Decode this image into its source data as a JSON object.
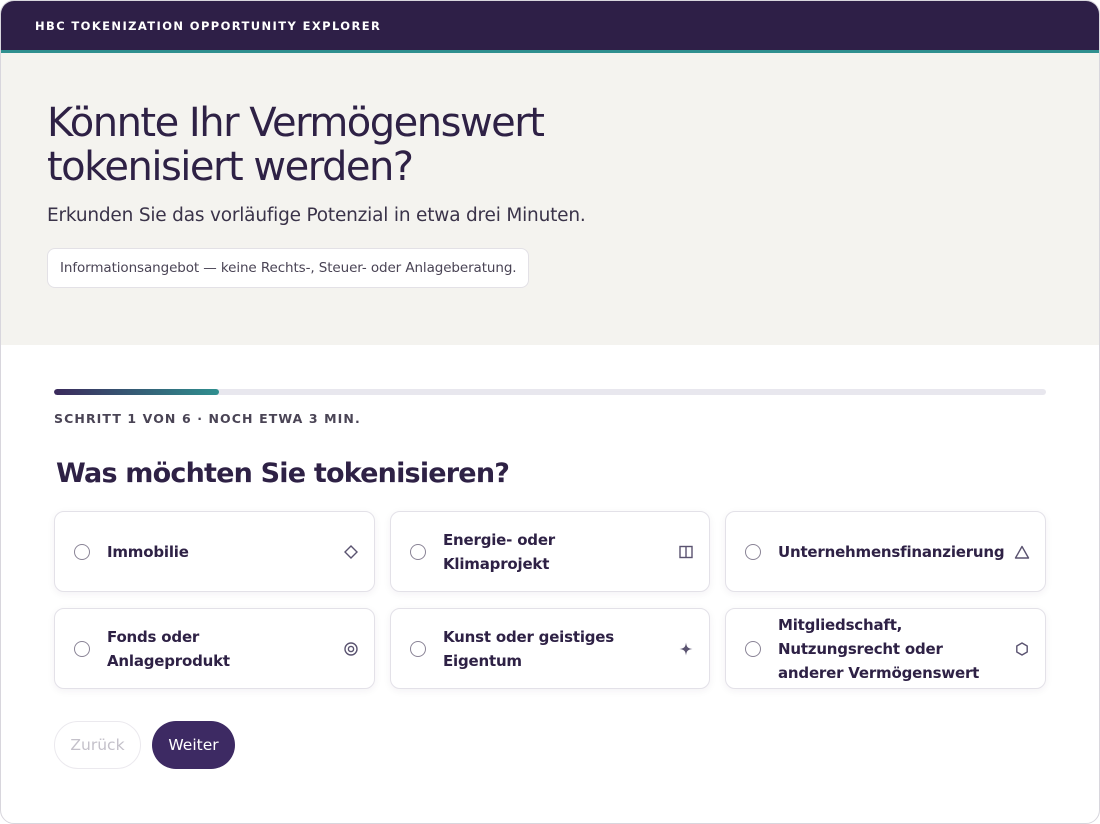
{
  "app": {
    "brand": "HBC TOKENIZATION OPPORTUNITY EXPLORER",
    "colors": {
      "header": "#2e1f47",
      "accent": "#2f8f8f",
      "primary": "#3d2a63"
    }
  },
  "hero": {
    "title": "Könnte Ihr Vermögenswert tokenisiert werden?",
    "subtitle": "Erkunden Sie das vorläufige Potenzial in etwa drei Minuten.",
    "disclaimer": "Informationsangebot — keine Rechts-, Steuer- oder Anlageberatung."
  },
  "progress": {
    "current_step": 1,
    "total_steps": 6,
    "fraction": 0.1667,
    "label": "SCHRITT 1 VON 6 · NOCH ETWA 3 MIN."
  },
  "question": "Was möchten Sie tokenisieren?",
  "options": [
    {
      "label": "Immobilie",
      "icon": "diamond-icon",
      "selected": false
    },
    {
      "label": "Energie- oder Klimaprojekt",
      "icon": "split-square-icon",
      "selected": false
    },
    {
      "label": "Unternehmensfinanzierung",
      "icon": "triangle-icon",
      "selected": false
    },
    {
      "label": "Fonds oder Anlageprodukt",
      "icon": "target-icon",
      "selected": false
    },
    {
      "label": "Kunst oder geistiges Eigentum",
      "icon": "sparkle-icon",
      "selected": false
    },
    {
      "label": "Mitgliedschaft, Nutzungsrecht oder anderer Vermögenswert",
      "icon": "hexagon-icon",
      "selected": false
    }
  ],
  "actions": {
    "back_label": "Zurück",
    "back_disabled": true,
    "next_label": "Weiter"
  }
}
